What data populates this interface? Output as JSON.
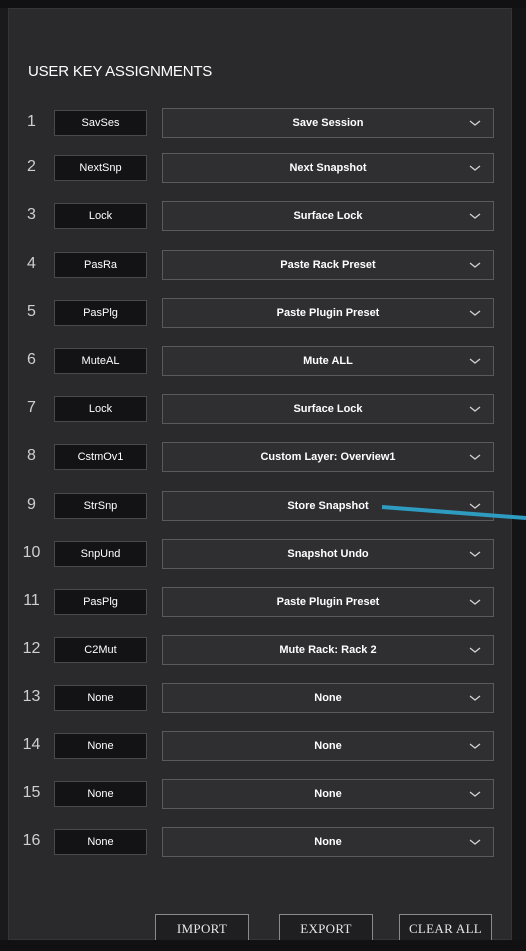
{
  "title": "USER KEY ASSIGNMENTS",
  "rows": [
    {
      "num": "1",
      "key": "SavSes",
      "action": "Save Session"
    },
    {
      "num": "2",
      "key": "NextSnp",
      "action": "Next Snapshot"
    },
    {
      "num": "3",
      "key": "Lock",
      "action": "Surface Lock"
    },
    {
      "num": "4",
      "key": "PasRa",
      "action": "Paste Rack Preset"
    },
    {
      "num": "5",
      "key": "PasPlg",
      "action": "Paste Plugin Preset"
    },
    {
      "num": "6",
      "key": "MuteAL",
      "action": "Mute ALL"
    },
    {
      "num": "7",
      "key": "Lock",
      "action": "Surface Lock"
    },
    {
      "num": "8",
      "key": "CstmOv1",
      "action": "Custom Layer: Overview1"
    },
    {
      "num": "9",
      "key": "StrSnp",
      "action": "Store Snapshot"
    },
    {
      "num": "10",
      "key": "SnpUnd",
      "action": "Snapshot Undo"
    },
    {
      "num": "11",
      "key": "PasPlg",
      "action": "Paste Plugin Preset"
    },
    {
      "num": "12",
      "key": "C2Mut",
      "action": "Mute Rack: Rack 2"
    },
    {
      "num": "13",
      "key": "None",
      "action": "None"
    },
    {
      "num": "14",
      "key": "None",
      "action": "None"
    },
    {
      "num": "15",
      "key": "None",
      "action": "None"
    },
    {
      "num": "16",
      "key": "None",
      "action": "None"
    }
  ],
  "buttons": {
    "import": "IMPORT",
    "export": "EXPORT",
    "clear_all": "CLEAR ALL"
  },
  "icons": {
    "dropdown": "chevron-down-icon",
    "annotation": "arrow-annotation"
  },
  "colors": {
    "panel_bg": "#2a2a2c",
    "key_bg": "#131315",
    "arrow": "#2e9bc0"
  }
}
